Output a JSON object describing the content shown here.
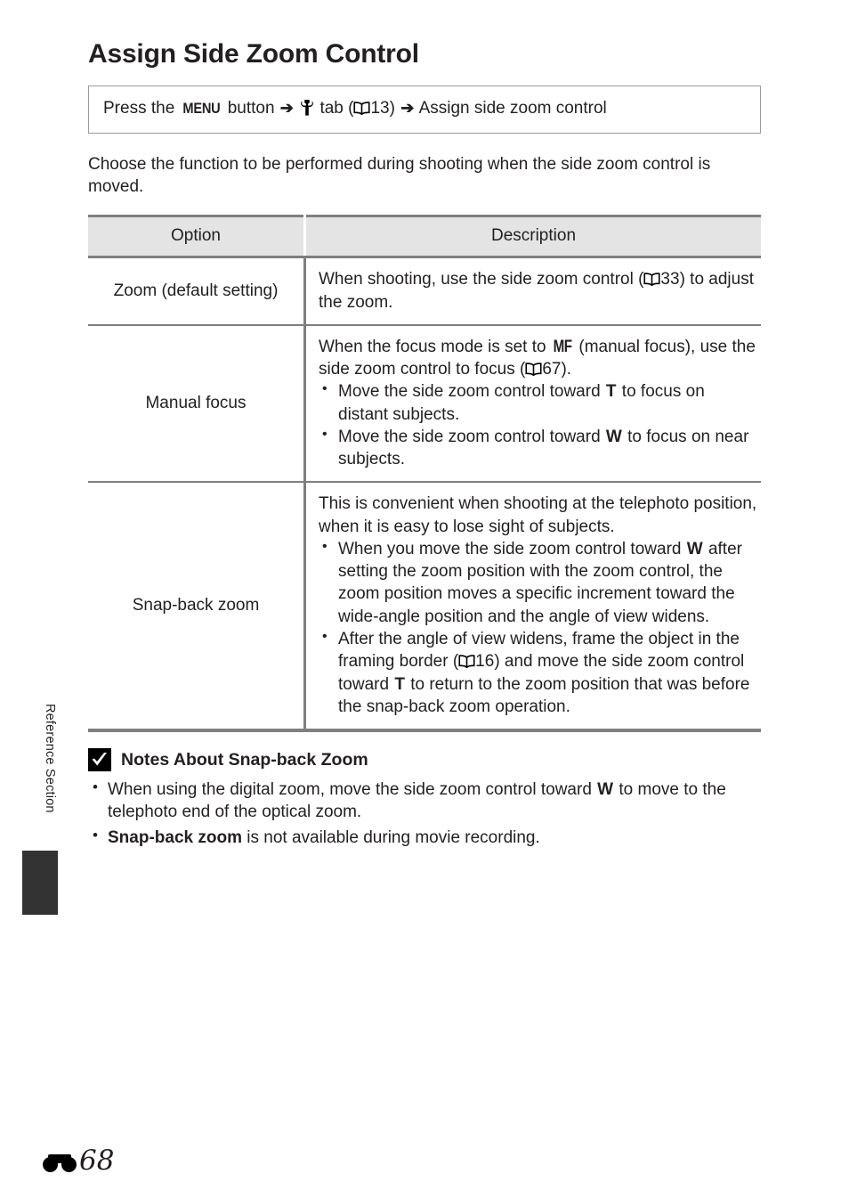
{
  "page": {
    "title": "Assign Side Zoom Control",
    "section_label": "Reference Section",
    "page_number": "68",
    "ref_mark_icon": "reference-section-icon"
  },
  "menu_path": {
    "press_the": "Press the",
    "menu_button_glyph": "MENU",
    "button_word": "button",
    "arrow": "➔",
    "setup_tab_icon": "wrench-icon",
    "tab_word": "tab",
    "open_paren": "(",
    "book_icon": "book-icon",
    "page_ref": "13",
    "close_paren": ")",
    "arrow2": "➔",
    "destination": "Assign side zoom control"
  },
  "intro": "Choose the function to be performed during shooting when the side zoom control is moved.",
  "table": {
    "headers": {
      "option": "Option",
      "description": "Description"
    },
    "rows": [
      {
        "option": "Zoom (default setting)",
        "desc_lead_a": "When shooting, use the side zoom control (",
        "desc_page_ref": "33",
        "desc_lead_b": ") to adjust the zoom.",
        "bullets": []
      },
      {
        "option": "Manual focus",
        "desc_lead_a": "When the focus mode is set to ",
        "mf_glyph": "MF",
        "desc_lead_b": " (manual focus), use the side zoom control to focus (",
        "desc_page_ref": "67",
        "desc_lead_c": ").",
        "bullets": [
          {
            "part_a": "Move the side zoom control toward ",
            "glyph": "T",
            "part_b": " to focus on distant subjects."
          },
          {
            "part_a": "Move the side zoom control toward ",
            "glyph": "W",
            "part_b": " to focus on near subjects."
          }
        ]
      },
      {
        "option": "Snap-back zoom",
        "desc_lead_a": "This is convenient when shooting at the telephoto position, when it is easy to lose sight of subjects.",
        "bullets": [
          {
            "part_a": "When you move the side zoom control toward ",
            "glyph": "W",
            "part_b": " after setting the zoom position with the zoom control, the zoom position moves a specific increment toward the wide-angle position and the angle of view widens."
          },
          {
            "part_a": "After the angle of view widens, frame the object in the framing border (",
            "page_ref": "16",
            "part_b": ") and move the side zoom control toward ",
            "glyph": "T",
            "part_c": " to return to the zoom position that was before the snap-back zoom operation."
          }
        ]
      }
    ]
  },
  "notes": {
    "icon": "checkmark-box-icon",
    "title": "Notes About Snap-back Zoom",
    "items": [
      {
        "part_a": "When using the digital zoom, move the side zoom control toward ",
        "glyph": "W",
        "part_b": " to move to the telephoto end of the optical zoom."
      },
      {
        "bold_lead": "Snap-back zoom",
        "part_b": " is not available during movie recording."
      }
    ]
  },
  "colors": {
    "text": "#231f20",
    "table_header_bg": "#e4e4e4",
    "table_border": "#7f7f7f",
    "tab_block": "#333333",
    "box_border": "#9b9b9b"
  }
}
